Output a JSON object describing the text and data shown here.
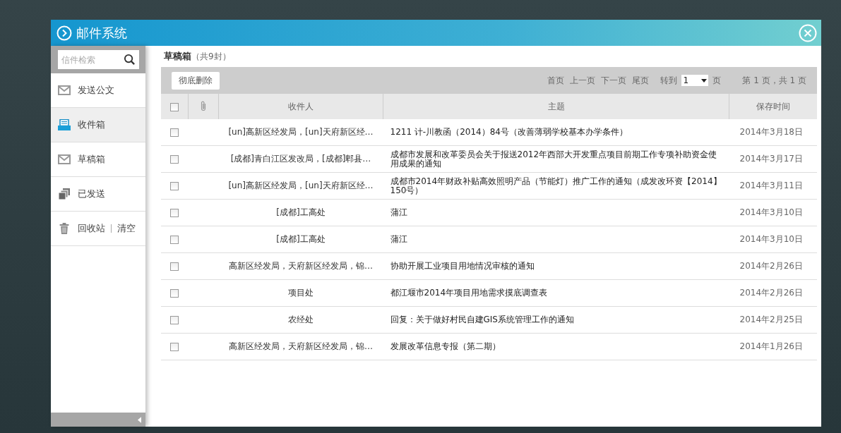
{
  "window": {
    "title": "邮件系统"
  },
  "sidebar": {
    "search": {
      "placeholder": "信件检索"
    },
    "items": [
      {
        "kind": "mail",
        "label": "发送公文",
        "selected": false
      },
      {
        "kind": "inbox",
        "label": "收件箱",
        "selected": true
      },
      {
        "kind": "mail",
        "label": "草稿箱",
        "selected": false
      },
      {
        "kind": "sent",
        "label": "已发送",
        "selected": false
      },
      {
        "kind": "trash",
        "label": "回收站",
        "action": "清空",
        "selected": false
      }
    ]
  },
  "folder": {
    "name": "草稿箱",
    "count": "（共9封）"
  },
  "toolbar": {
    "delete_button": "彻底删除",
    "first": "首页",
    "prev": "上一页",
    "next": "下一页",
    "last": "尾页",
    "goto": "转到",
    "page_select": "1",
    "page_unit": "页",
    "page_info": "第 1 页，共 1 页"
  },
  "table": {
    "select_all": false,
    "columns": [
      "收件人",
      "主题",
      "保存时间"
    ],
    "rows": [
      {
        "checked": false,
        "recipient": "[un]高新区经发局，[un]天府新区经…",
        "subject": "1211 计-川教函（2014）84号（改善薄弱学校基本办学条件）",
        "time": "2014年3月18日"
      },
      {
        "checked": false,
        "recipient": "[成都]青白江区发改局，[成都]郫县…",
        "subject": "成都市发展和改革委员会关于报送2012年西部大开发重点项目前期工作专项补助资金使用成果的通知",
        "time": "2014年3月17日"
      },
      {
        "checked": false,
        "recipient": "[un]高新区经发局，[un]天府新区经…",
        "subject": "成都市2014年财政补贴高效照明产品（节能灯）推广工作的通知（成发改环资【2014】150号）",
        "time": "2014年3月11日"
      },
      {
        "checked": false,
        "recipient": "[成都]工高处",
        "subject": "蒲江",
        "time": "2014年3月10日"
      },
      {
        "checked": false,
        "recipient": "[成都]工高处",
        "subject": "蒲江",
        "time": "2014年3月10日"
      },
      {
        "checked": false,
        "recipient": "高新区经发局，天府新区经发局，锦…",
        "subject": "协助开展工业项目用地情况审核的通知",
        "time": "2014年2月26日"
      },
      {
        "checked": false,
        "recipient": "项目处",
        "subject": "都江堰市2014年项目用地需求摸底调查表",
        "time": "2014年2月26日"
      },
      {
        "checked": false,
        "recipient": "农经处",
        "subject": "回复：关于做好村民自建GIS系统管理工作的通知",
        "time": "2014年2月25日"
      },
      {
        "checked": false,
        "recipient": "高新区经发局，天府新区经发局，锦…",
        "subject": "发展改革信息专报（第二期）",
        "time": "2014年1月26日"
      }
    ]
  }
}
